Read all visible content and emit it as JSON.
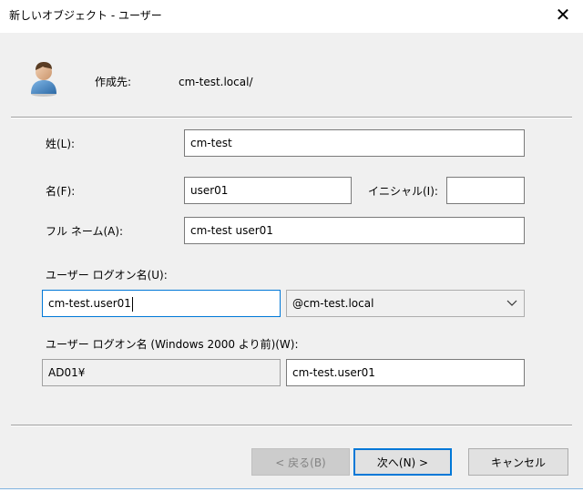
{
  "window": {
    "title": "新しいオブジェクト - ユーザー",
    "close_glyph": "✕"
  },
  "header": {
    "create_in_label": "作成先:",
    "create_in_value": "cm-test.local/"
  },
  "form": {
    "last_name_label": "姓(L):",
    "last_name_value": "cm-test",
    "first_name_label": "名(F):",
    "first_name_value": "user01",
    "initials_label": "イニシャル(I):",
    "initials_value": "",
    "full_name_label": "フル ネーム(A):",
    "full_name_value": "cm-test user01",
    "logon_name_label": "ユーザー ログオン名(U):",
    "logon_name_value": "cm-test.user01",
    "domain_selected": "@cm-test.local",
    "pre2000_label": "ユーザー ログオン名 (Windows 2000 より前)(W):",
    "pre2000_domain_value": "AD01¥",
    "pre2000_name_value": "cm-test.user01"
  },
  "buttons": {
    "back_label": "< 戻る(B)",
    "next_label": "次へ(N) >",
    "cancel_label": "キャンセル"
  },
  "icons": {
    "user": "user-icon",
    "close": "close-icon",
    "dropdown": "chevron-down-icon"
  },
  "colors": {
    "focus": "#0078d7",
    "dialog_bg": "#f0f0f0",
    "disabled_text": "#838383"
  }
}
